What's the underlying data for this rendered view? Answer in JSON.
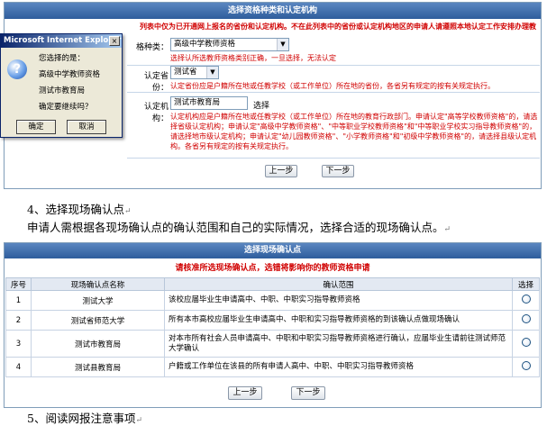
{
  "panel1": {
    "header": "选择资格种类和认定机构",
    "note": "列表中仅为已开通网上报名的省份和认定机构。不在此列表中的省份或认定机构地区的申请人请遵照本地认定工作安排办理教师资格申请",
    "note2": "",
    "fields": {
      "qualification": {
        "label": "格种类：",
        "value": "高级中学教师资格",
        "hint": "选择认所选教师资格类别正确，一旦选择，无法认定"
      },
      "province": {
        "label": "认定省份：",
        "value": "测试省",
        "hint": "认定省份应是户籍所在地或任教学校（或工作单位）所在地的省份，各省另有规定的按有关规定执行。"
      },
      "agency": {
        "label": "认定机构：",
        "value": "测试市教育局",
        "button": "选择",
        "hint": "认定机构应是户籍所在地或任教学校（或工作单位）所在地的教育行政部门。申请认定\"高等学校教师资格\"的，请选择省级认定机构；申请认定\"高级中学教师资格\"、\"中等职业学校教师资格\"和\"中等职业学校实习指导教师资格\"的，请选择地市级认定机构；申请认定\"幼儿园教师资格\"、\"小学教师资格\"和\"初级中学教师资格\"的，请选择县级认定机构。各省另有规定的按有关规定执行。"
      }
    },
    "buttons": {
      "prev": "上一步",
      "next": "下一步"
    }
  },
  "dialog": {
    "title": "Microsoft Internet Explorer",
    "close": "×",
    "icon": "?",
    "lines": [
      "您选择的是：",
      "高级中学教师资格",
      "测试市教育局",
      "确定要继续吗？"
    ],
    "ok": "确定",
    "cancel": "取消"
  },
  "doc": {
    "step4_title": "4、选择现场确认点",
    "step4_desc": "申请人需根据各现场确认点的确认范围和自己的实际情况，选择合适的现场确认点。",
    "step5_title": "5、阅读网报注意事项",
    "para_mark": "↵"
  },
  "panel2": {
    "header": "选择现场确认点",
    "warning": "请核准所选现场确认点，选错将影响你的教师资格申请",
    "columns": [
      "序号",
      "现场确认点名称",
      "确认范围",
      "选择"
    ],
    "rows": [
      {
        "no": "1",
        "name": "测试大学",
        "scope": "该校应届毕业生申请高中、中职、中职实习指导教师资格"
      },
      {
        "no": "2",
        "name": "测试省师范大学",
        "scope": "所有本市高校应届毕业生申请高中、中职和实习指导教师资格的到该确认点做现场确认"
      },
      {
        "no": "3",
        "name": "测试市教育局",
        "scope": "对本市所有社会人员申请高中、中职和中职实习指导教师资格进行确认，应届毕业生请前往测试师范大学确认"
      },
      {
        "no": "4",
        "name": "测试县教育局",
        "scope": "户籍或工作单位在该县的所有申请人高中、中职、中职实习指导教师资格"
      }
    ],
    "buttons": {
      "prev": "上一步",
      "next": "下一步"
    }
  }
}
